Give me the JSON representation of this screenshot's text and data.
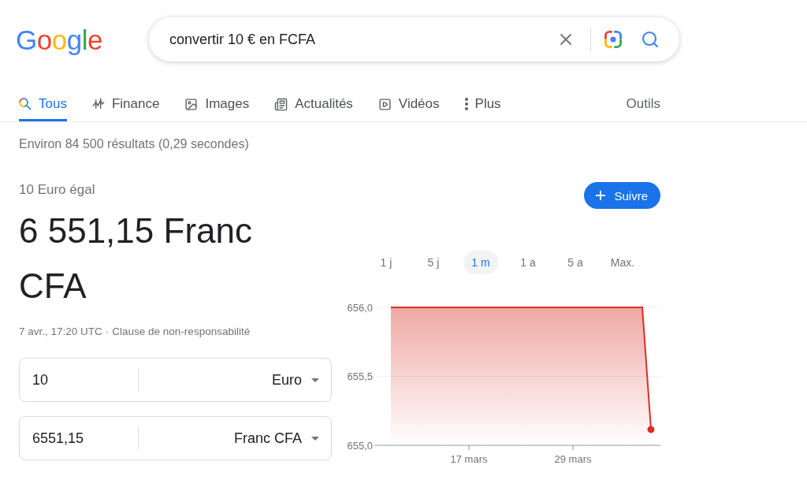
{
  "logo": {
    "text": "Google"
  },
  "search": {
    "query": "convertir 10 € en FCFA"
  },
  "tabs": [
    {
      "label": "Tous",
      "selected": true
    },
    {
      "label": "Finance",
      "selected": false
    },
    {
      "label": "Images",
      "selected": false
    },
    {
      "label": "Actualités",
      "selected": false
    },
    {
      "label": "Vidéos",
      "selected": false
    },
    {
      "label": "Plus",
      "selected": false
    }
  ],
  "tools": "Outils",
  "result_stats": "Environ 84 500 résultats (0,29 secondes)",
  "converter": {
    "intro": "10 Euro égal",
    "result": "6 551,15 Franc CFA",
    "timestamp": "7 avr., 17:20 UTC",
    "separator": "·",
    "disclaimer": "Clause de non-responsabilité",
    "rows": [
      {
        "amount": "10",
        "currency": "Euro"
      },
      {
        "amount": "6551,15",
        "currency": "Franc CFA"
      }
    ]
  },
  "chart": {
    "follow_button": "Suivre",
    "ranges": [
      {
        "label": "1 j",
        "selected": false
      },
      {
        "label": "5 j",
        "selected": false
      },
      {
        "label": "1 m",
        "selected": true
      },
      {
        "label": "1 a",
        "selected": false
      },
      {
        "label": "5 a",
        "selected": false
      },
      {
        "label": "Max.",
        "selected": false
      }
    ],
    "chart_data": {
      "type": "area",
      "categories": [
        null,
        null,
        null,
        null,
        null,
        null,
        null,
        null,
        null,
        "17 mars",
        null,
        null,
        null,
        null,
        null,
        null,
        null,
        null,
        null,
        null,
        null,
        "29 mars",
        null,
        null,
        null,
        null,
        null,
        null,
        null,
        null,
        null
      ],
      "series": [
        {
          "color": "#d93025",
          "values": [
            656.0,
            656.0,
            656.0,
            656.0,
            656.0,
            656.0,
            656.0,
            656.0,
            656.0,
            656.0,
            656.0,
            656.0,
            656.0,
            656.0,
            656.0,
            656.0,
            656.0,
            656.0,
            656.0,
            656.0,
            656.0,
            656.0,
            656.0,
            656.0,
            656.0,
            656.0,
            656.0,
            656.0,
            656.0,
            656.0,
            655.115
          ]
        }
      ],
      "ylim": [
        655.0,
        656.0
      ],
      "yticks": [
        {
          "value": 656.0,
          "label": "656,0"
        },
        {
          "value": 655.5,
          "label": "655,5"
        },
        {
          "value": 655.0,
          "label": "655,0"
        }
      ]
    }
  }
}
